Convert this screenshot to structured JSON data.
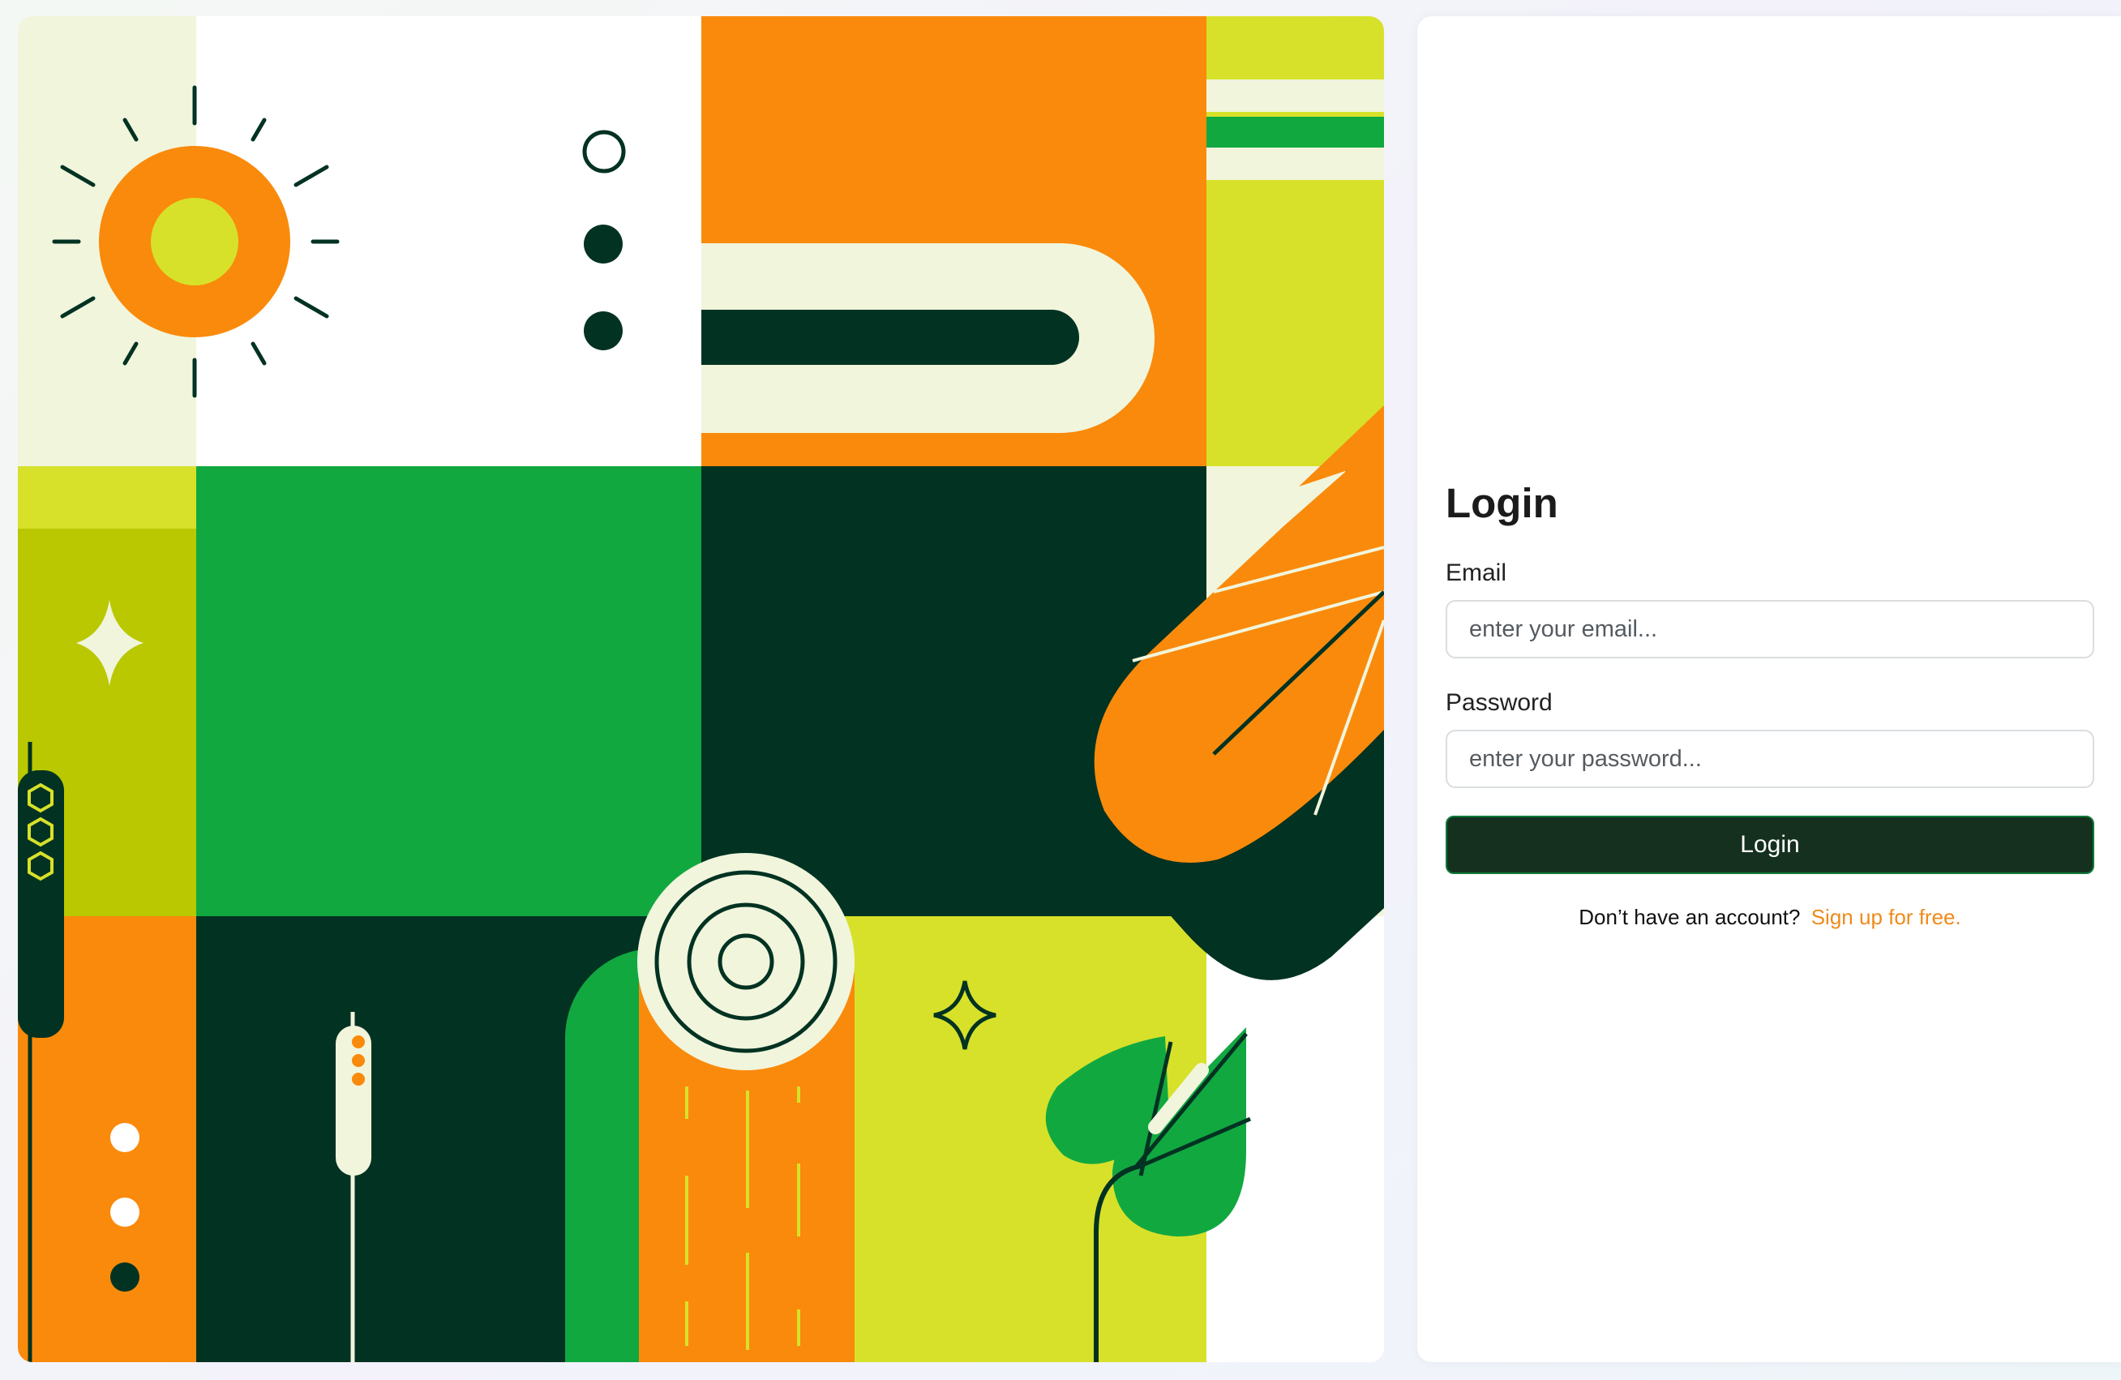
{
  "login": {
    "title": "Login",
    "email_label": "Email",
    "email_placeholder": "enter your email...",
    "email_value": "",
    "password_label": "Password",
    "password_placeholder": "enter your password...",
    "password_value": "",
    "submit_label": "Login",
    "signup_prompt": "Don’t have an account?",
    "signup_link": "Sign up for free."
  },
  "colors": {
    "dark_green": "#023222",
    "green": "#11a840",
    "lime": "#d7e12a",
    "olive": "#b9c800",
    "orange": "#fa8a0b",
    "cream": "#f1f5dc",
    "button_bg": "#15301f",
    "link": "#ef8a1a"
  },
  "illustration": {
    "icons": [
      "sun-icon",
      "leaf-icon",
      "tree-ring-icon",
      "sparkle-icon",
      "cattail-icon",
      "plant-icon"
    ]
  }
}
